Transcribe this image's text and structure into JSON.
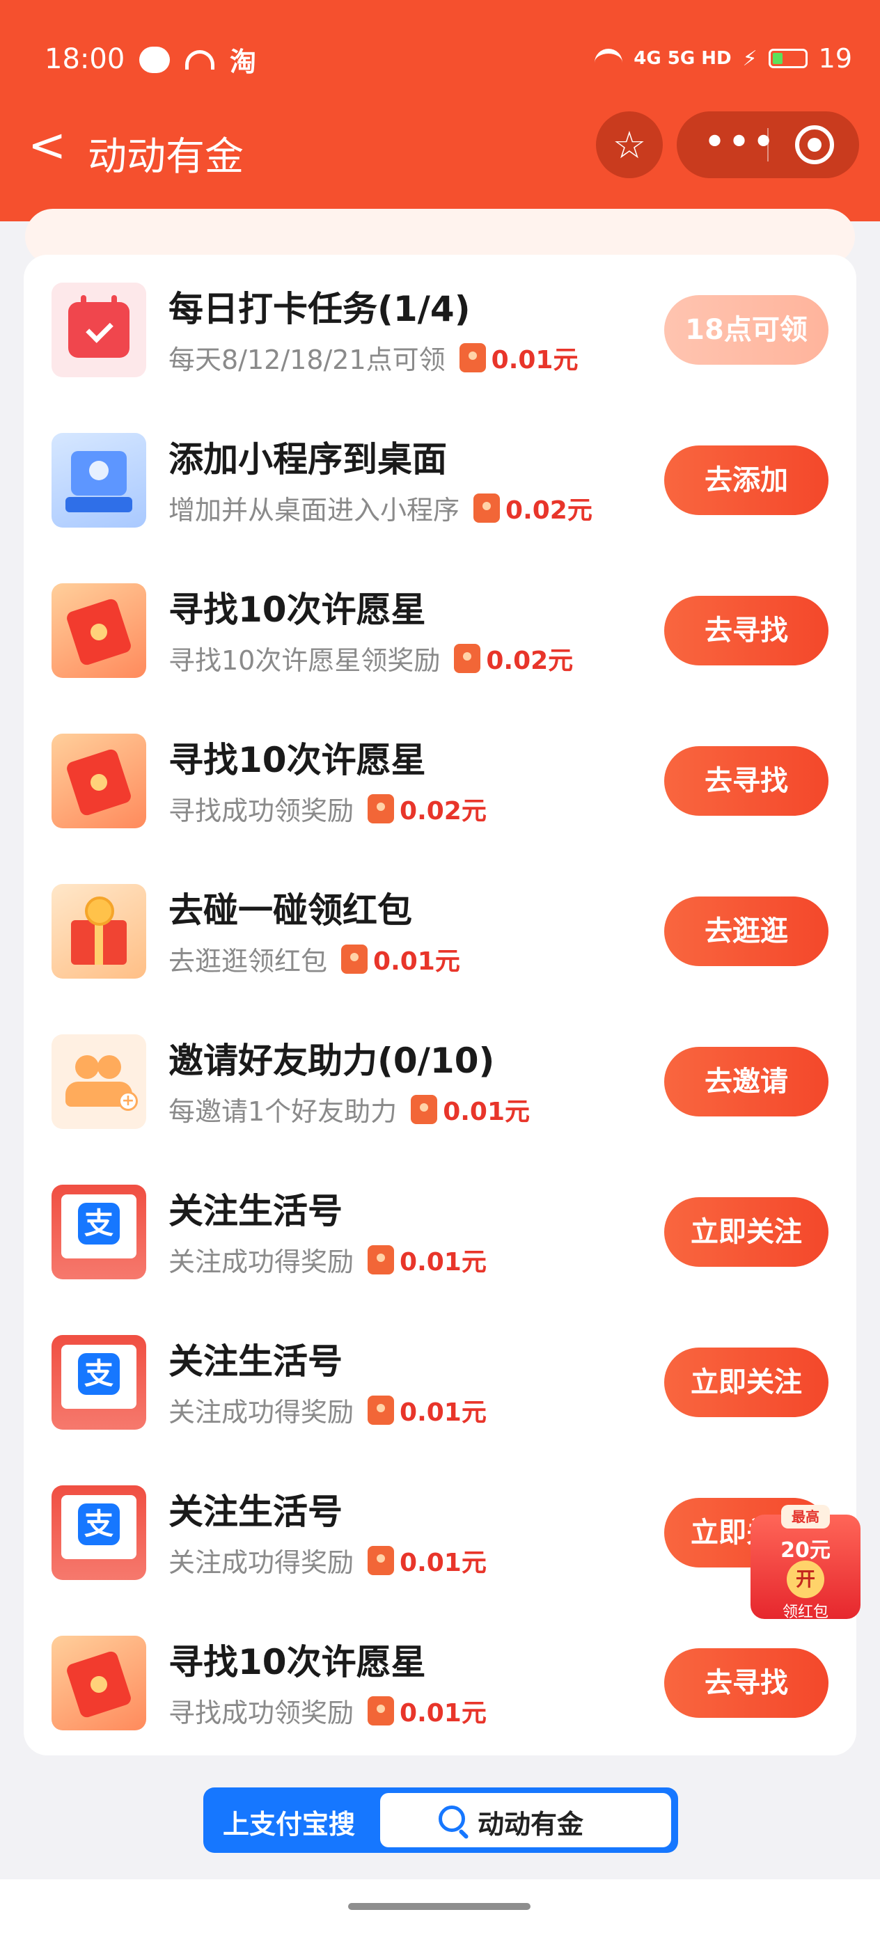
{
  "status": {
    "time": "18:00",
    "app_icons": [
      "wechat-icon",
      "call-icon",
      "taobao-icon"
    ],
    "taobao_label": "淘",
    "network": "4G 5G HD",
    "battery": "19"
  },
  "header": {
    "back": "<",
    "title": "动动有金"
  },
  "tasks": [
    {
      "title": "每日打卡任务(1/4)",
      "desc": "每天8/12/18/21点可领",
      "reward": "0.01元",
      "button": "18点可领",
      "icon": "calendar-icon",
      "disabled": true
    },
    {
      "title": "添加小程序到桌面",
      "desc": "增加并从桌面进入小程序",
      "reward": "0.02元",
      "button": "去添加",
      "icon": "desktop-icon"
    },
    {
      "title": "寻找10次许愿星",
      "desc": "寻找10次许愿星领奖励",
      "reward": "0.02元",
      "button": "去寻找",
      "icon": "red-packet-icon"
    },
    {
      "title": "寻找10次许愿星",
      "desc": "寻找成功领奖励",
      "reward": "0.02元",
      "button": "去寻找",
      "icon": "red-packet-icon"
    },
    {
      "title": "去碰一碰领红包",
      "desc": "去逛逛领红包",
      "reward": "0.01元",
      "button": "去逛逛",
      "icon": "gift-box-icon"
    },
    {
      "title": "邀请好友助力(0/10)",
      "desc": "每邀请1个好友助力",
      "reward": "0.01元",
      "button": "去邀请",
      "icon": "invite-friend-icon"
    },
    {
      "title": "关注生活号",
      "desc": "关注成功得奖励",
      "reward": "0.01元",
      "button": "立即关注",
      "icon": "alipay-icon"
    },
    {
      "title": "关注生活号",
      "desc": "关注成功得奖励",
      "reward": "0.01元",
      "button": "立即关注",
      "icon": "alipay-icon"
    },
    {
      "title": "关注生活号",
      "desc": "关注成功得奖励",
      "reward": "0.01元",
      "button": "立即关注",
      "icon": "alipay-icon"
    },
    {
      "title": "寻找10次许愿星",
      "desc": "寻找成功领奖励",
      "reward": "0.01元",
      "button": "去寻找",
      "icon": "red-packet-icon"
    }
  ],
  "float_redpacket": {
    "top": "最高",
    "amount": "20元",
    "open": "开",
    "label": "领红包"
  },
  "search": {
    "prefix": "上支付宝搜",
    "keyword": "动动有金"
  },
  "alipay_glyph": "支",
  "colors": {
    "brand": "#f5502e",
    "alipay_blue": "#1677ff",
    "reward_red": "#e8352a"
  }
}
